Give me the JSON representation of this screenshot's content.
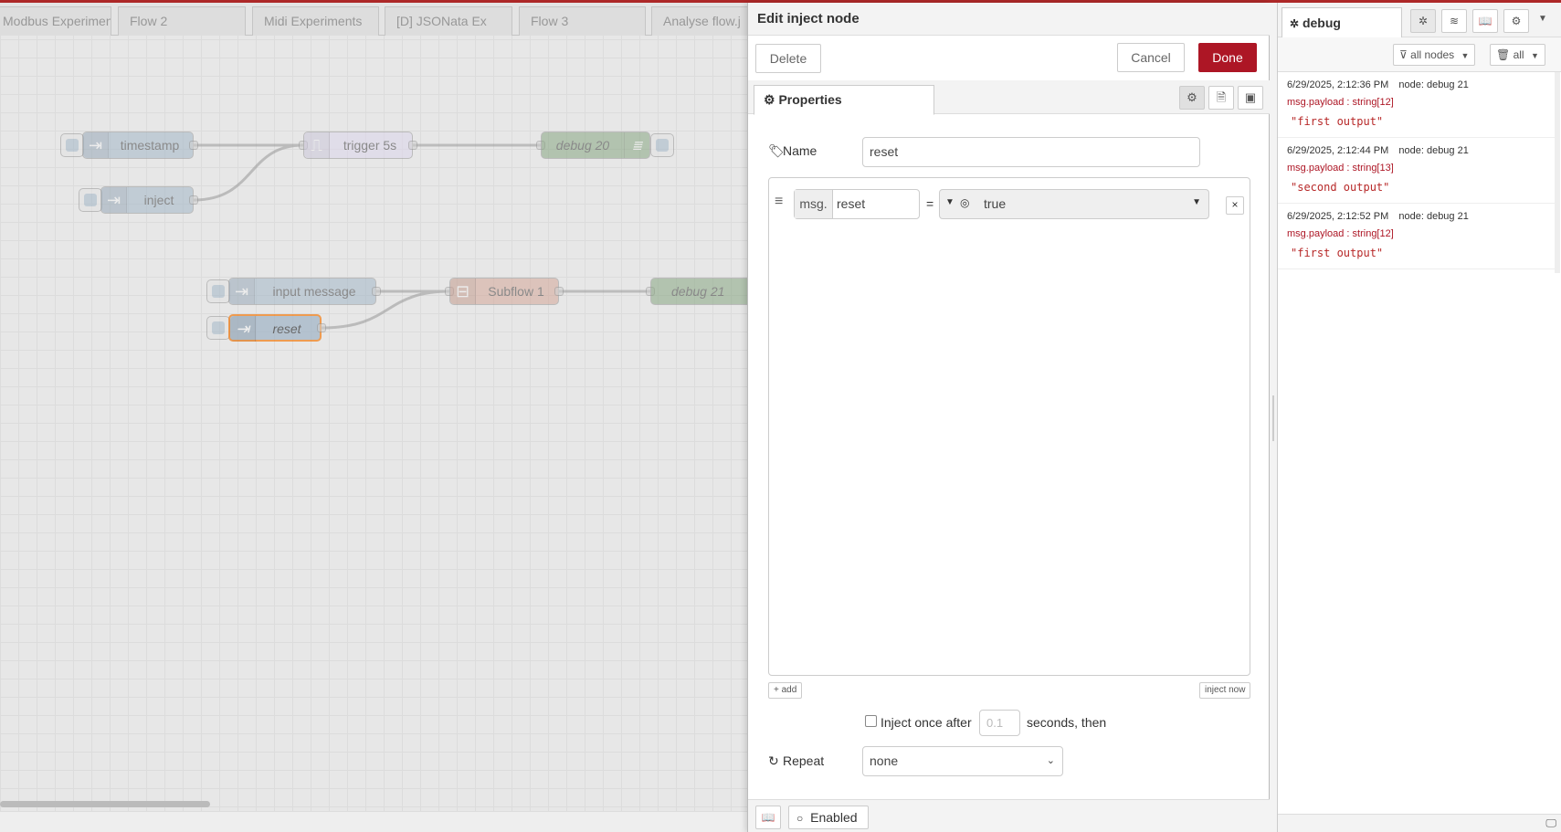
{
  "workspace": {
    "tabs": [
      "Modbus Experiment",
      "Flow 2",
      "Midi Experiments",
      "[D] JSONata Ex",
      "Flow 3",
      "Analyse flow.j"
    ],
    "nodes": {
      "timestamp": "timestamp",
      "inject": "inject",
      "trigger": "trigger 5s",
      "debug20": "debug 20",
      "input_message": "input message",
      "reset": "reset",
      "subflow": "Subflow 1",
      "debug21": "debug 21"
    }
  },
  "tray": {
    "title": "Edit inject node",
    "delete_label": "Delete",
    "cancel_label": "Cancel",
    "done_label": "Done",
    "properties_tab": "Properties",
    "name_label": "Name",
    "name_value": "reset",
    "prop_prefix": "msg.",
    "prop_name": "reset",
    "prop_equals": "=",
    "prop_value": "true",
    "add_label": "add",
    "inject_now_label": "inject now",
    "inject_once_label": "Inject once after",
    "inject_once_value": "0.1",
    "inject_once_suffix": "seconds, then",
    "repeat_label": "Repeat",
    "repeat_value": "none",
    "enabled_label": "Enabled"
  },
  "sidebar": {
    "tab_label": "debug",
    "filter_label": "all nodes",
    "clear_label": "all",
    "messages": [
      {
        "time": "6/29/2025, 2:12:36 PM",
        "node": "node: debug 21",
        "type": "msg.payload : string[12]",
        "value": "\"first output\""
      },
      {
        "time": "6/29/2025, 2:12:44 PM",
        "node": "node: debug 21",
        "type": "msg.payload : string[13]",
        "value": "\"second output\""
      },
      {
        "time": "6/29/2025, 2:12:52 PM",
        "node": "node: debug 21",
        "type": "msg.payload : string[12]",
        "value": "\"first output\""
      }
    ]
  },
  "colors": {
    "brand_red": "#ad1625",
    "inject_node": "#a6bbcf",
    "trigger_node": "#e6e0f8",
    "debug_node": "#87a980",
    "subflow_node": "#ddaa99",
    "selected_outline": "#ff7f0e"
  }
}
